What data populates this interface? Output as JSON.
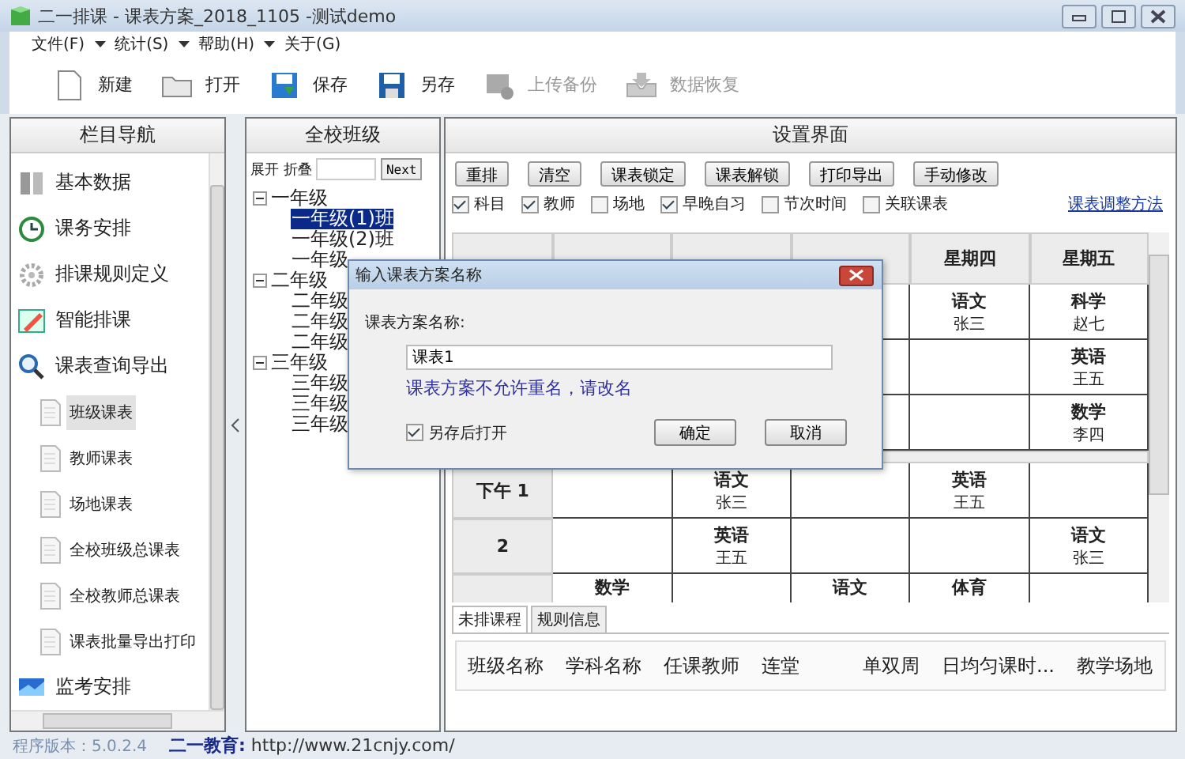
{
  "window": {
    "title": "二一排课 - 课表方案_2018_1105 -测试demo"
  },
  "menu": [
    {
      "label": "文件(F)",
      "dropdown": true
    },
    {
      "label": "统计(S)",
      "dropdown": true
    },
    {
      "label": "帮助(H)",
      "dropdown": true
    },
    {
      "label": "关于(G)",
      "dropdown": false
    }
  ],
  "toolbar": [
    {
      "label": "新建",
      "kind": "new",
      "disabled": false
    },
    {
      "label": "打开",
      "kind": "open",
      "disabled": false
    },
    {
      "label": "保存",
      "kind": "save",
      "disabled": false
    },
    {
      "label": "另存",
      "kind": "saveas",
      "disabled": false
    },
    {
      "label": "上传备份",
      "kind": "upload",
      "disabled": true
    },
    {
      "label": "数据恢复",
      "kind": "restore",
      "disabled": true
    }
  ],
  "nav": {
    "title": "栏目导航",
    "items": [
      {
        "label": "基本数据",
        "kind": "data",
        "selected": false
      },
      {
        "label": "课务安排",
        "kind": "clock",
        "selected": false
      },
      {
        "label": "排课规则定义",
        "kind": "gear",
        "selected": false
      },
      {
        "label": "智能排课",
        "kind": "pencil",
        "selected": false
      },
      {
        "label": "课表查询导出",
        "kind": "search",
        "selected": false,
        "children": [
          {
            "label": "班级课表",
            "selected": true
          },
          {
            "label": "教师课表",
            "selected": false
          },
          {
            "label": "场地课表",
            "selected": false
          },
          {
            "label": "全校班级总课表",
            "selected": false
          },
          {
            "label": "全校教师总课表",
            "selected": false
          },
          {
            "label": "课表批量导出打印",
            "selected": false
          }
        ]
      },
      {
        "label": "监考安排",
        "kind": "monitor",
        "selected": false
      }
    ]
  },
  "tree": {
    "title": "全校班级",
    "expand": "展开",
    "collapse": "折叠",
    "search_button": "Next",
    "nodes": [
      {
        "label": "一年级",
        "expanded": true,
        "children": [
          {
            "label": "一年级(1)班",
            "selected": true
          },
          {
            "label": "一年级(2)班",
            "selected": false
          },
          {
            "label": "一年级",
            "selected": false
          }
        ]
      },
      {
        "label": "二年级",
        "expanded": true,
        "children": [
          {
            "label": "二年级",
            "selected": false
          },
          {
            "label": "二年级",
            "selected": false
          },
          {
            "label": "二年级",
            "selected": false
          }
        ]
      },
      {
        "label": "三年级",
        "expanded": true,
        "children": [
          {
            "label": "三年级",
            "selected": false
          },
          {
            "label": "三年级",
            "selected": false
          },
          {
            "label": "三年级",
            "selected": false
          }
        ]
      }
    ]
  },
  "setup": {
    "title": "设置界面",
    "buttons": [
      "重排",
      "清空",
      "课表锁定",
      "课表解锁",
      "打印导出",
      "手动修改"
    ],
    "options": [
      {
        "label": "科目",
        "checked": true
      },
      {
        "label": "教师",
        "checked": true
      },
      {
        "label": "场地",
        "checked": false
      },
      {
        "label": "早晚自习",
        "checked": true
      },
      {
        "label": "节次时间",
        "checked": false
      },
      {
        "label": "关联课表",
        "checked": false
      }
    ],
    "link": "课表调整方法",
    "timetable": {
      "days": [
        "星期四",
        "星期五"
      ],
      "rows": [
        {
          "kind": "lesson",
          "cells": [
            {},
            {},
            {},
            {
              "subject": "语文",
              "teacher": "张三"
            },
            {
              "subject": "科学",
              "teacher": "赵七"
            }
          ]
        },
        {
          "kind": "lesson",
          "cells": [
            {},
            {},
            {},
            {},
            {
              "subject": "英语",
              "teacher": "王五"
            }
          ]
        },
        {
          "kind": "lesson",
          "cells": [
            {},
            {},
            {},
            {},
            {
              "subject": "数学",
              "teacher": "李四"
            }
          ]
        },
        {
          "kind": "break"
        },
        {
          "kind": "lesson",
          "label": "下午 1",
          "cells": [
            {},
            {
              "subject": "语文",
              "teacher": "张三"
            },
            {},
            {
              "subject": "英语",
              "teacher": "王五"
            },
            {}
          ]
        },
        {
          "kind": "lesson",
          "label": "2",
          "cells": [
            {},
            {
              "subject": "英语",
              "teacher": "王五"
            },
            {},
            {},
            {
              "subject": "语文",
              "teacher": "张三"
            }
          ]
        },
        {
          "kind": "partial",
          "cells": [
            {
              "subject": "数学"
            },
            {},
            {
              "subject": "语文"
            },
            {
              "subject": "体育"
            },
            {}
          ]
        }
      ]
    },
    "tabs": [
      {
        "label": "未排课程",
        "selected": true
      },
      {
        "label": "规则信息",
        "selected": false
      }
    ],
    "columns": [
      "班级名称",
      "学科名称",
      "任课教师",
      "连堂",
      "单双周",
      "日均匀课时...",
      "教学场地"
    ]
  },
  "dialog": {
    "title": "输入课表方案名称",
    "label": "课表方案名称:",
    "value": "课表1",
    "error": "课表方案不允许重名，请改名",
    "open_after": {
      "label": "另存后打开",
      "checked": true
    },
    "buttons": [
      "确定",
      "取消"
    ]
  },
  "status_bar": {
    "version": "程序版本：5.0.2.4",
    "site": "**二一教育:** http://www.21cnjy.com/"
  }
}
